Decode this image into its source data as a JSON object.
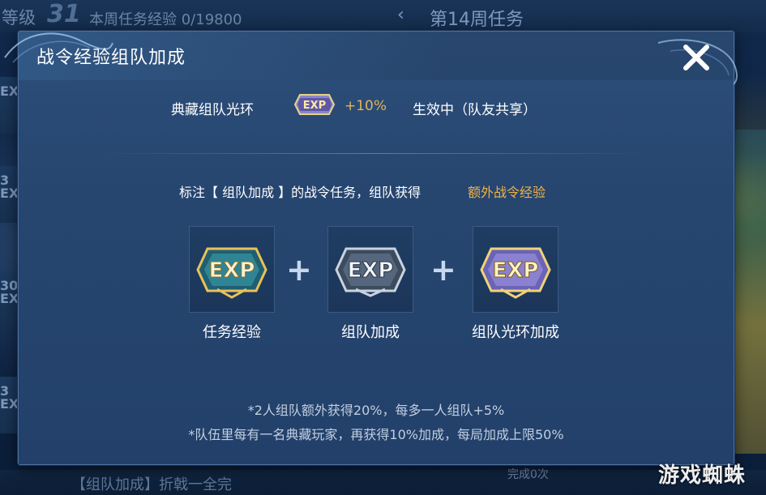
{
  "background": {
    "level_label": "等级",
    "level_value": "31",
    "weekly_progress": "本周任务经验 0/19800",
    "back_icon": "chevron-left-icon",
    "week_title": "第14周任务",
    "side_cards": [
      "EX",
      "3",
      "EX",
      "30",
      "EX",
      "3",
      "EX"
    ],
    "bottom_left_text": "【组队加成】折戟一全完",
    "bottom_right_text": "完成0次",
    "watermark": "游戏蜘蛛"
  },
  "dialog": {
    "title": "战令经验组队加成",
    "close_icon": "close-icon",
    "aura": {
      "name": "典藏组队光环",
      "icon": "exp-badge-icon",
      "icon_text": "EXP",
      "bonus": "+10%",
      "status": "生效中（队友共享）"
    },
    "description_prefix": "标注【 组队加成 】的战令任务，组队获得",
    "description_highlight": "额外战令经验",
    "bonus_items": [
      {
        "label": "任务经验",
        "icon": "exp-gold-icon",
        "icon_text": "EXP"
      },
      {
        "label": "组队加成",
        "icon": "exp-silver-icon",
        "icon_text": "EXP"
      },
      {
        "label": "组队光环加成",
        "icon": "exp-purple-icon",
        "icon_text": "EXP"
      }
    ],
    "plus_symbol": "+",
    "notes": [
      "*2人组队额外获得20%，每多一人组队+5%",
      "*队伍里每有一名典藏玩家，再获得10%加成，每局加成上限50%"
    ]
  },
  "colors": {
    "highlight": "#f0b247",
    "bonus": "#e3b455",
    "dialog_bg": "#24426a",
    "border": "#4d72a3"
  }
}
